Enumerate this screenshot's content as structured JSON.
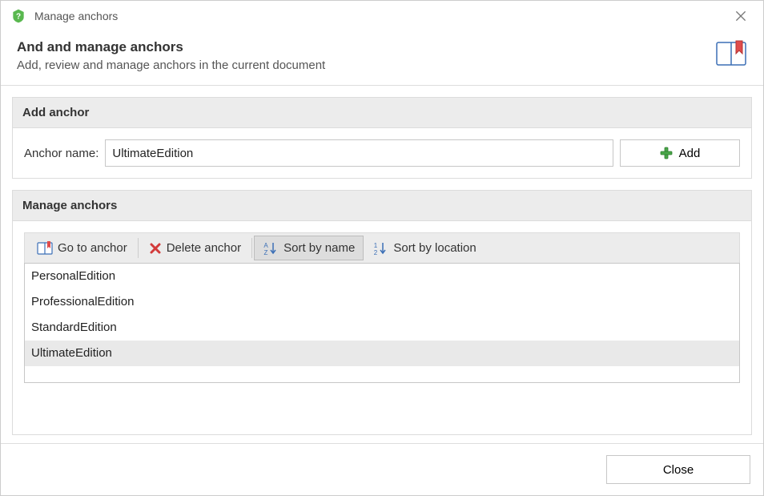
{
  "window": {
    "title": "Manage anchors"
  },
  "header": {
    "title": "And and manage anchors",
    "subtitle": "Add, review and manage anchors in the current document"
  },
  "addAnchor": {
    "groupTitle": "Add anchor",
    "label": "Anchor name:",
    "value": "UltimateEdition",
    "addButton": "Add"
  },
  "manageAnchors": {
    "groupTitle": "Manage anchors",
    "toolbar": {
      "goTo": "Go to anchor",
      "delete": "Delete anchor",
      "sortName": "Sort by name",
      "sortLocation": "Sort by location"
    },
    "items": [
      {
        "name": "PersonalEdition",
        "selected": false
      },
      {
        "name": "ProfessionalEdition",
        "selected": false
      },
      {
        "name": "StandardEdition",
        "selected": false
      },
      {
        "name": "UltimateEdition",
        "selected": true
      }
    ]
  },
  "footer": {
    "close": "Close"
  }
}
